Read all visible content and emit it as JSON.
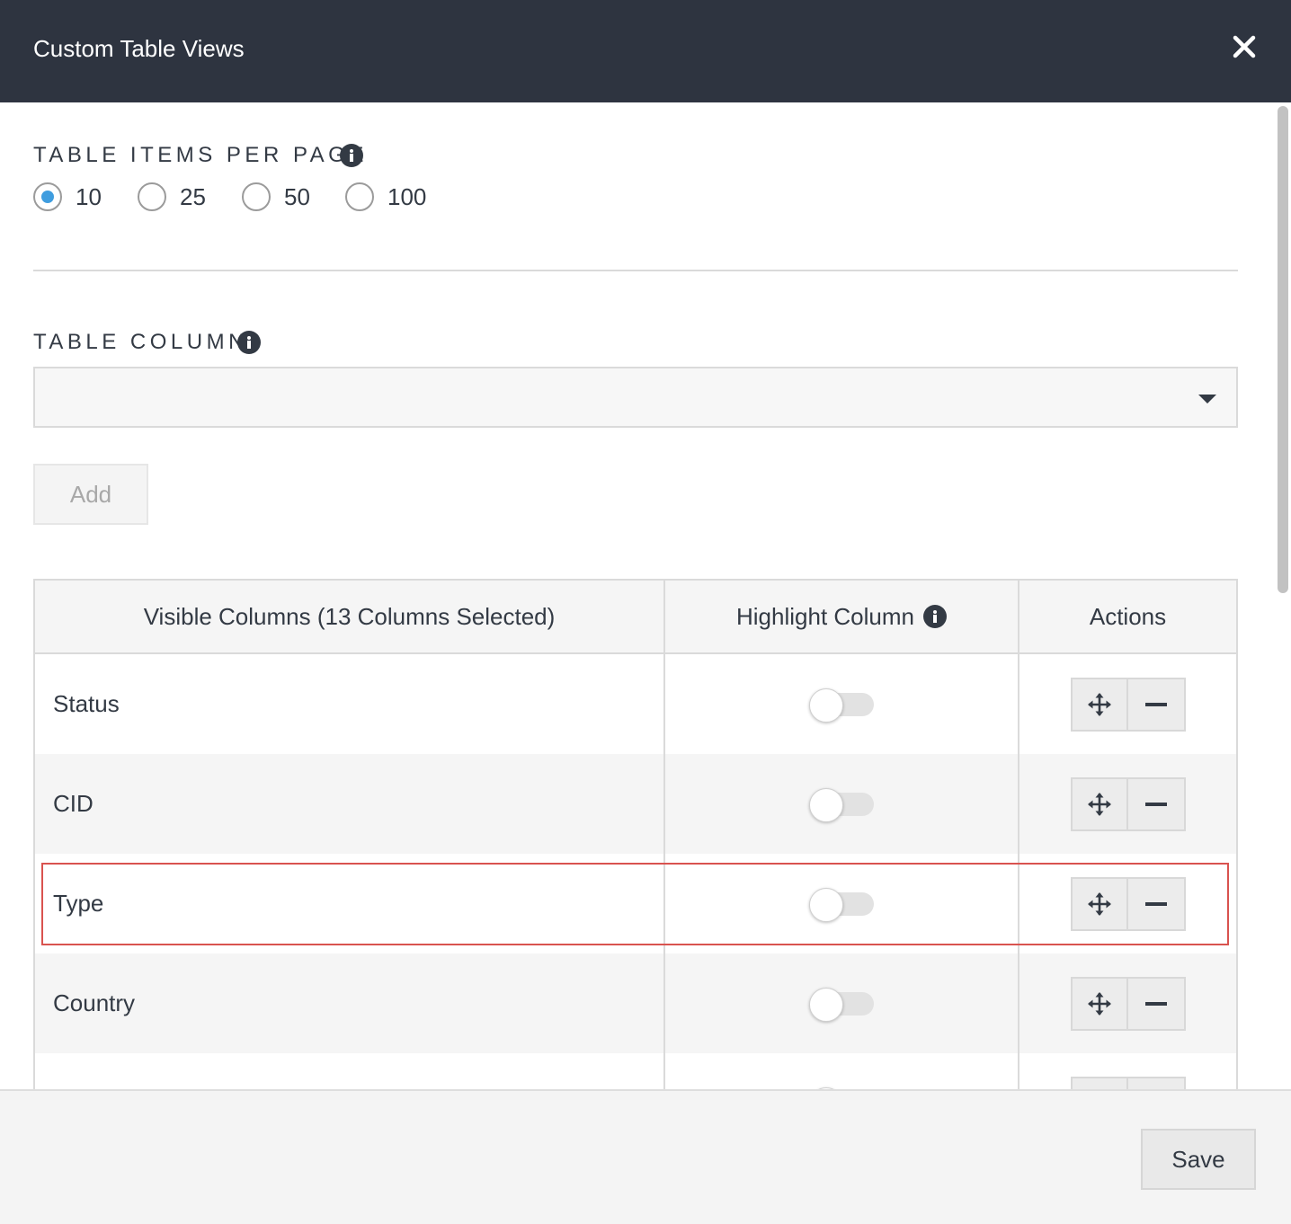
{
  "dialog": {
    "title": "Custom Table Views",
    "close_icon": "close-icon"
  },
  "items_per_page": {
    "label": "TABLE ITEMS PER PAGE",
    "info_icon": "info-icon",
    "options": [
      {
        "label": "10",
        "checked": true
      },
      {
        "label": "25",
        "checked": false
      },
      {
        "label": "50",
        "checked": false
      },
      {
        "label": "100",
        "checked": false
      }
    ],
    "selected": "10"
  },
  "table_column": {
    "label": "TABLE COLUMN",
    "info_icon": "info-icon",
    "select_value": "",
    "add_label": "Add"
  },
  "columns_table": {
    "headers": {
      "visible": "Visible Columns (13 Columns Selected)",
      "highlight": "Highlight Column",
      "actions": "Actions"
    },
    "rows": [
      {
        "name": "Status",
        "highlight": false
      },
      {
        "name": "CID",
        "highlight": false
      },
      {
        "name": "Type",
        "highlight": false
      },
      {
        "name": "Country",
        "highlight": false
      },
      {
        "name": "",
        "highlight": false
      }
    ],
    "row_action_icons": [
      "move-icon",
      "minus-icon"
    ]
  },
  "footer": {
    "save_label": "Save"
  },
  "colors": {
    "header_bg": "#2e3440",
    "radio_checked": "#3f9ddf",
    "highlight_border": "#d9534f"
  }
}
